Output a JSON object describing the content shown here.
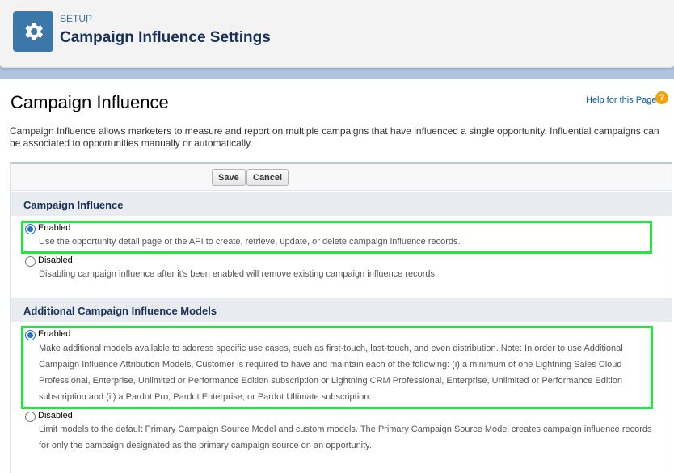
{
  "header": {
    "breadcrumb": "SETUP",
    "title": "Campaign Influence Settings",
    "icon": "gear-icon",
    "icon_color": "#3b77a8"
  },
  "main": {
    "heading": "Campaign Influence",
    "help_link": "Help for this Page",
    "help_icon": "question-icon",
    "intro": "Campaign Influence allows marketers to measure and report on multiple campaigns that have influenced a single opportunity. Influential campaigns can be associated to opportunities manually or automatically."
  },
  "toolbar": {
    "save_label": "Save",
    "cancel_label": "Cancel"
  },
  "sections": [
    {
      "title": "Campaign Influence",
      "options": [
        {
          "label": "Enabled",
          "checked": true,
          "description": "Use the opportunity detail page or the API to create, retrieve, update, or delete campaign influence records."
        },
        {
          "label": "Disabled",
          "checked": false,
          "description": "Disabling campaign influence after it's been enabled will remove existing campaign influence records."
        }
      ]
    },
    {
      "title": "Additional Campaign Influence Models",
      "options": [
        {
          "label": "Enabled",
          "checked": true,
          "description": "Make additional models available to address specific use cases, such as first-touch, last-touch, and even distribution. Note: In order to use Additional Campaign Influence Attribution Models, Customer is required to have and maintain each of the following: (i) a minimum of one Lightning Sales Cloud Professional, Enterprise, Unlimited or Performance Edition subscription or Lightning CRM Professional, Enterprise, Unlimited or Performance Edition subscription and (ii) a Pardot Pro, Pardot Enterprise, or Pardot Ultimate subscription."
        },
        {
          "label": "Disabled",
          "checked": false,
          "description": "Limit models to the default Primary Campaign Source Model and custom models. The Primary Campaign Source Model creates campaign influence records for only the campaign designated as the primary campaign source on an opportunity."
        }
      ]
    }
  ],
  "colors": {
    "highlight": "#1ee83a",
    "radio_selected": "#1e73c9",
    "title_color": "#16325c"
  }
}
